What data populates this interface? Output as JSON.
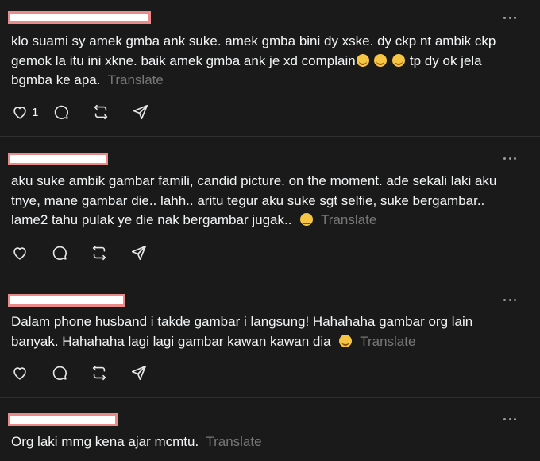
{
  "posts": [
    {
      "text": "klo suami sy amek gmba ank suke. amek gmba bini dy xske. dy ckp nt ambik ckp gemok la itu ini xkne. baik amek gmba ank je xd complain",
      "text_after": " tp dy ok jela bgmba ke apa.",
      "emojis": [
        "rolling-on-floor-laughing",
        "rolling-on-floor-laughing",
        "rolling-on-floor-laughing"
      ],
      "translate": "Translate",
      "like_count": "1"
    },
    {
      "text": "aku suke ambik gambar famili, candid picture. on the moment. ade sekali laki aku tnye, mane gambar die.. lahh.. aritu tegur aku suke sgt selfie, suke bergambar.. lame2 tahu pulak ye die nak bergambar jugak..",
      "emojis": [
        "downcast-face-with-sweat"
      ],
      "translate": "Translate"
    },
    {
      "text": "Dalam phone husband i takde gambar i langsung! Hahahaha gambar org lain banyak. Hahahaha lagi lagi gambar kawan kawan dia",
      "emojis": [
        "grinning-squinting-face"
      ],
      "translate": "Translate"
    },
    {
      "text": "Org laki mmg kena ajar mcmtu.",
      "translate": "Translate"
    }
  ]
}
